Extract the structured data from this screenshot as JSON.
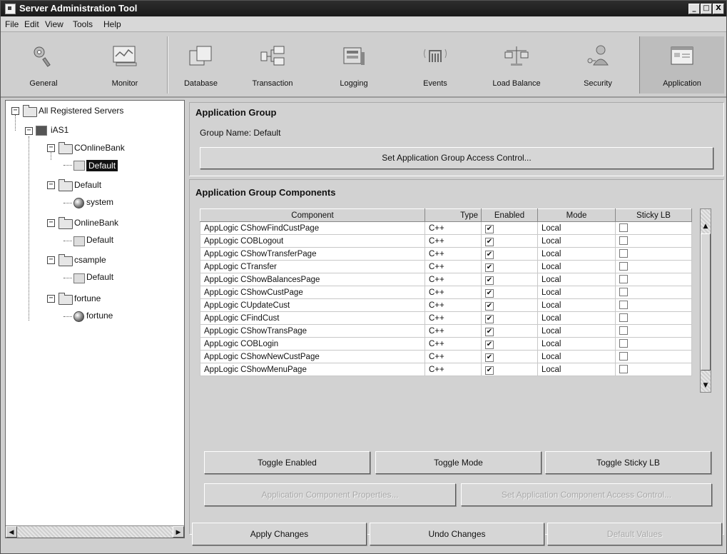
{
  "window": {
    "title": "Server Administration Tool",
    "controls": {
      "minimize": "_",
      "maximize": "□",
      "close": "X"
    }
  },
  "menu": [
    "File",
    "Edit",
    "View",
    "Tools",
    "Help"
  ],
  "toolbar": [
    {
      "label": "General",
      "icon": "general-icon"
    },
    {
      "label": "Monitor",
      "icon": "monitor-icon"
    },
    {
      "label": "Database",
      "icon": "database-icon"
    },
    {
      "label": "Transaction",
      "icon": "transaction-icon"
    },
    {
      "label": "Logging",
      "icon": "logging-icon"
    },
    {
      "label": "Events",
      "icon": "events-icon"
    },
    {
      "label": "Load Balance",
      "icon": "load-balance-icon"
    },
    {
      "label": "Security",
      "icon": "security-icon"
    },
    {
      "label": "Application",
      "icon": "application-icon",
      "active": true
    }
  ],
  "tree": {
    "root": "All Registered Servers",
    "server": "iAS1",
    "groups": [
      {
        "name": "COnlineBank",
        "children": [
          "Default"
        ],
        "selected_child": "Default"
      },
      {
        "name": "Default",
        "children": [
          "system"
        ]
      },
      {
        "name": "OnlineBank",
        "children": [
          "Default"
        ]
      },
      {
        "name": "csample",
        "children": [
          "Default"
        ]
      },
      {
        "name": "fortune",
        "children": [
          "fortune"
        ]
      }
    ]
  },
  "app_group": {
    "title": "Application Group",
    "group_name_label": "Group Name:",
    "group_name_value": "Default",
    "access_button": "Set Application Group Access Control..."
  },
  "components": {
    "title": "Application Group Components",
    "columns": [
      "Component",
      "Type",
      "Enabled",
      "Mode",
      "Sticky LB"
    ],
    "rows": [
      {
        "component": "AppLogic CShowFindCustPage",
        "type": "C++",
        "enabled": true,
        "mode": "Local",
        "sticky": false
      },
      {
        "component": "AppLogic COBLogout",
        "type": "C++",
        "enabled": true,
        "mode": "Local",
        "sticky": false
      },
      {
        "component": "AppLogic CShowTransferPage",
        "type": "C++",
        "enabled": true,
        "mode": "Local",
        "sticky": false
      },
      {
        "component": "AppLogic CTransfer",
        "type": "C++",
        "enabled": true,
        "mode": "Local",
        "sticky": false
      },
      {
        "component": "AppLogic CShowBalancesPage",
        "type": "C++",
        "enabled": true,
        "mode": "Local",
        "sticky": false
      },
      {
        "component": "AppLogic CShowCustPage",
        "type": "C++",
        "enabled": true,
        "mode": "Local",
        "sticky": false
      },
      {
        "component": "AppLogic CUpdateCust",
        "type": "C++",
        "enabled": true,
        "mode": "Local",
        "sticky": false
      },
      {
        "component": "AppLogic CFindCust",
        "type": "C++",
        "enabled": true,
        "mode": "Local",
        "sticky": false
      },
      {
        "component": "AppLogic CShowTransPage",
        "type": "C++",
        "enabled": true,
        "mode": "Local",
        "sticky": false
      },
      {
        "component": "AppLogic COBLogin",
        "type": "C++",
        "enabled": true,
        "mode": "Local",
        "sticky": false
      },
      {
        "component": "AppLogic CShowNewCustPage",
        "type": "C++",
        "enabled": true,
        "mode": "Local",
        "sticky": false
      },
      {
        "component": "AppLogic CShowMenuPage",
        "type": "C++",
        "enabled": true,
        "mode": "Local",
        "sticky": false
      }
    ],
    "check_glyph": "✔",
    "toggle_enabled": "Toggle Enabled",
    "toggle_mode": "Toggle Mode",
    "toggle_sticky": "Toggle Sticky LB",
    "component_properties": "Application Component Properties...",
    "component_access": "Set Application Component Access Control..."
  },
  "footer": {
    "apply": "Apply Changes",
    "undo": "Undo Changes",
    "defaults": "Default Values"
  }
}
